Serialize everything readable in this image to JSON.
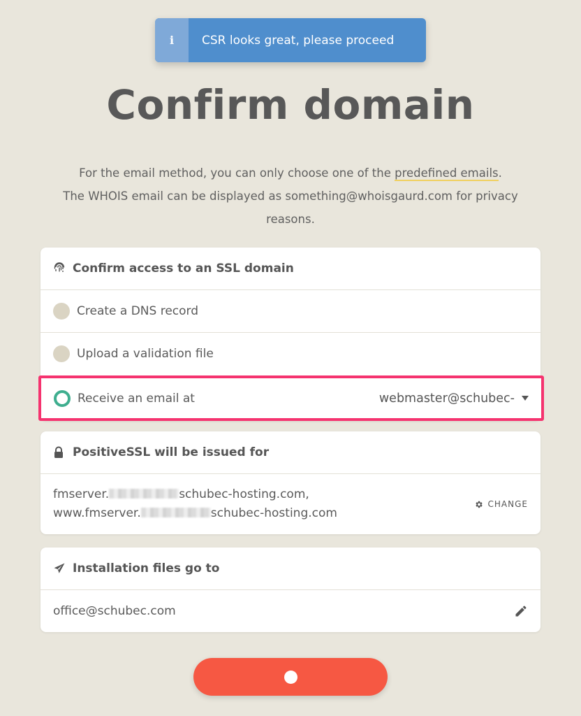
{
  "toast": {
    "icon": "info-icon",
    "glyph": "i",
    "message": "CSR looks great, please proceed"
  },
  "page": {
    "title": "Confirm domain",
    "description_part1": "For the email method, you can only choose one of the ",
    "description_link": "predefined emails",
    "description_part2": ".",
    "description_line2": "The WHOIS email can be displayed as something@whoisgaurd.com for privacy reasons."
  },
  "validation": {
    "header": "Confirm access to an SSL domain",
    "header_icon": "fingerprint-icon",
    "options": [
      {
        "label": "Create a DNS record",
        "selected": false
      },
      {
        "label": "Upload a validation file",
        "selected": false
      },
      {
        "label": "Receive an email at",
        "selected": true
      }
    ],
    "email_value": "webmaster@schubec-"
  },
  "issued": {
    "header": "PositiveSSL will be issued for",
    "header_icon": "lock-icon",
    "domain1_prefix": "fmserver.",
    "domain1_suffix": "schubec-hosting.com,",
    "domain2_prefix": "www.fmserver.",
    "domain2_suffix": "schubec-hosting.com",
    "change_label": "CHANGE",
    "change_icon": "gear-icon"
  },
  "installation": {
    "header": "Installation files go to",
    "header_icon": "paper-plane-icon",
    "email": "office@schubec.com",
    "edit_icon": "pencil-icon"
  },
  "submit": {
    "state": "loading"
  },
  "colors": {
    "background": "#e9e6dc",
    "toast": "#4f8ecd",
    "accent_selected": "#3fae8f",
    "highlight": "#f5336f",
    "submit": "#f65843"
  }
}
